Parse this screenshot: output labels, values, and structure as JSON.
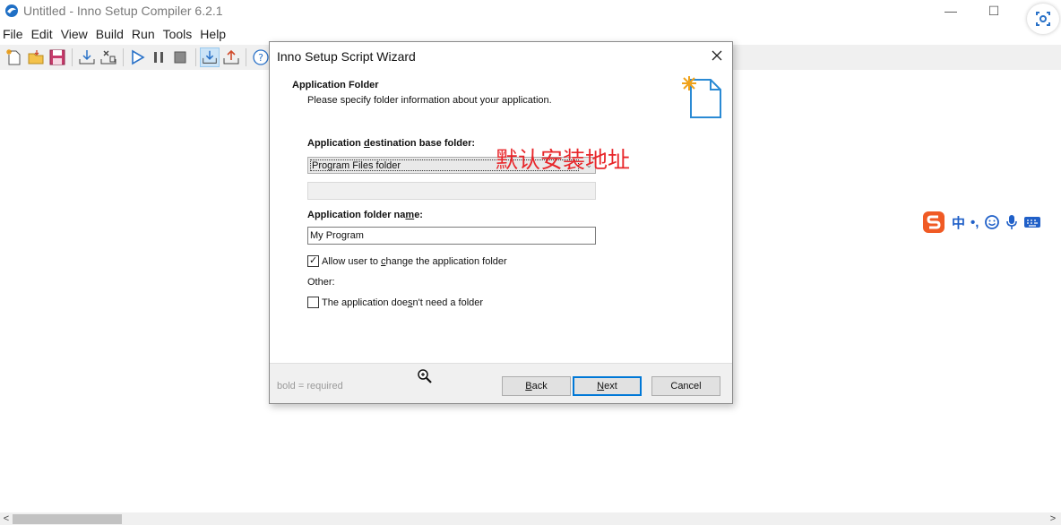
{
  "window": {
    "title": "Untitled - Inno Setup Compiler 6.2.1",
    "controls": {
      "minimize": "—",
      "maximize": "☐"
    }
  },
  "menu": [
    "File",
    "Edit",
    "View",
    "Build",
    "Run",
    "Tools",
    "Help"
  ],
  "toolbar": {
    "buttons": [
      "new-file",
      "open-file",
      "save",
      "compile",
      "compile-stop",
      "run",
      "pause",
      "stop",
      "download-target",
      "upload-target",
      "help"
    ]
  },
  "dialog": {
    "title": "Inno Setup Script Wizard",
    "close": "✕",
    "header_title": "Application Folder",
    "header_subtitle": "Please specify folder information about your application.",
    "dest_label_pre": "Application ",
    "dest_label_u": "d",
    "dest_label_post": "estination base folder:",
    "dest_value": "Program Files folder",
    "name_label_pre": "Application folder na",
    "name_label_u": "m",
    "name_label_post": "e:",
    "name_value": "My Program",
    "allow_change_pre": "Allow user to ",
    "allow_change_u": "c",
    "allow_change_post": "hange the application folder",
    "allow_change_checked": true,
    "other_label": "Other:",
    "no_folder_pre": "The application doe",
    "no_folder_u": "s",
    "no_folder_post": "n't need a folder",
    "no_folder_checked": false,
    "footer_note": "bold = required",
    "back_u": "B",
    "back_rest": "ack",
    "next_u": "N",
    "next_rest": "ext",
    "cancel": "Cancel"
  },
  "annotation": "默认安装地址",
  "ime": {
    "lang": "中",
    "punct": "•,",
    "icons": [
      "smiley-icon",
      "microphone-icon",
      "keyboard-icon"
    ]
  },
  "colors": {
    "annotation": "#e8262a",
    "accent": "#0078d7",
    "ime": "#2060c8"
  }
}
